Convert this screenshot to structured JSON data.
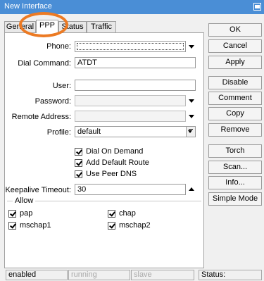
{
  "window": {
    "title": "New Interface"
  },
  "tabs": [
    {
      "label": "General"
    },
    {
      "label": "PPP"
    },
    {
      "label": "Status"
    },
    {
      "label": "Traffic"
    }
  ],
  "form": {
    "phone": {
      "label": "Phone:",
      "value": ""
    },
    "dial_command": {
      "label": "Dial Command:",
      "value": "ATDT"
    },
    "user": {
      "label": "User:",
      "value": ""
    },
    "password": {
      "label": "Password:",
      "value": ""
    },
    "remote_address": {
      "label": "Remote Address:",
      "value": ""
    },
    "profile": {
      "label": "Profile:",
      "value": "default"
    },
    "dial_on_demand": {
      "label": "Dial On Demand",
      "checked": true
    },
    "add_default_route": {
      "label": "Add Default Route",
      "checked": true
    },
    "use_peer_dns": {
      "label": "Use Peer DNS",
      "checked": true
    },
    "keepalive_timeout": {
      "label": "Keepalive Timeout:",
      "value": "30"
    },
    "allow": {
      "label": "Allow",
      "pap": {
        "label": "pap",
        "checked": true
      },
      "chap": {
        "label": "chap",
        "checked": true
      },
      "mschap1": {
        "label": "mschap1",
        "checked": true
      },
      "mschap2": {
        "label": "mschap2",
        "checked": true
      }
    }
  },
  "buttons": {
    "ok": "OK",
    "cancel": "Cancel",
    "apply": "Apply",
    "disable": "Disable",
    "comment": "Comment",
    "copy": "Copy",
    "remove": "Remove",
    "torch": "Torch",
    "scan": "Scan...",
    "info": "Info...",
    "simple_mode": "Simple Mode"
  },
  "statusbar": {
    "enabled": "enabled",
    "running": "running",
    "slave": "slave",
    "status": "Status:"
  },
  "colors": {
    "titlebar": "#4a8ed6",
    "highlight_ring": "#ec7a23"
  }
}
